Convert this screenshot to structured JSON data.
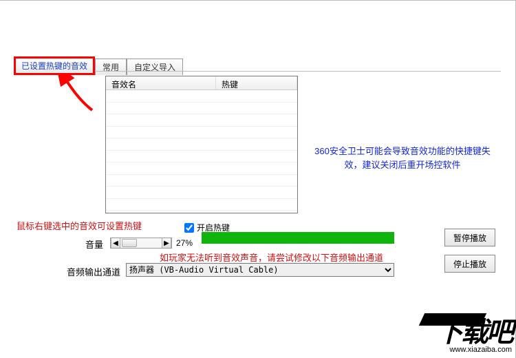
{
  "tabs": {
    "hotkey_effects": "已设置热键的音效",
    "common": "常用",
    "custom_import": "自定义导入"
  },
  "list": {
    "col_name": "音效名",
    "col_hotkey": "热键"
  },
  "info_right": "360安全卫士可能会导致音效功能的快捷键失效，建议关闭后重开场控软件",
  "hint_set_hotkey": "鼠标右键选中的音效可设置热键",
  "checkbox_enable_hotkey": "开启热键",
  "volume": {
    "label": "音量",
    "percent": "27%"
  },
  "hint_output": "如玩家无法听到音效声音，请尝试修改以下音频输出通道",
  "output": {
    "label": "音频输出通道",
    "selected": "扬声器 (VB-Audio Virtual Cable)"
  },
  "buttons": {
    "pause": "暂停播放",
    "stop": "停止播放"
  },
  "watermark": {
    "brand": "下载吧",
    "url": "www.xiazaiba.com"
  }
}
